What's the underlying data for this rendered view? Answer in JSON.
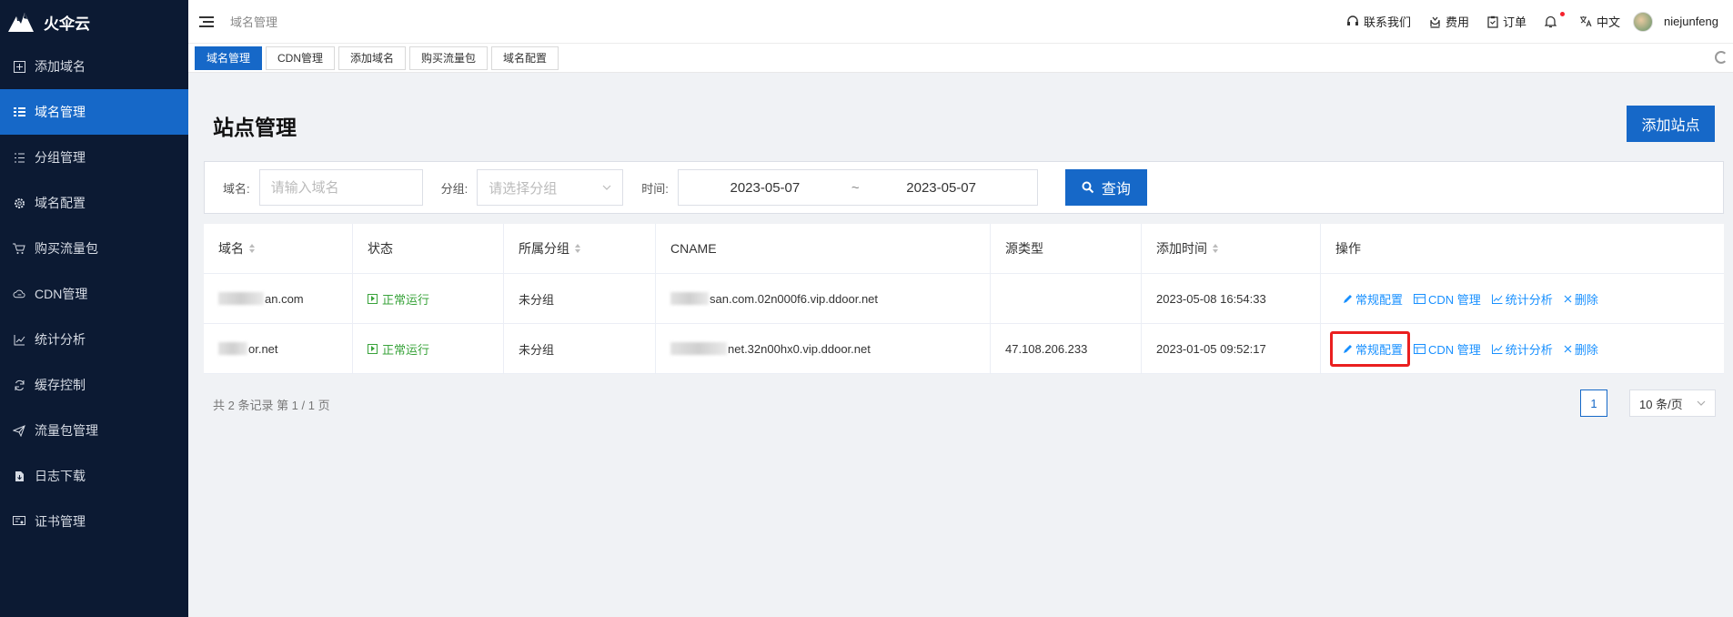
{
  "brand": {
    "name": "火伞云"
  },
  "sidebar": {
    "items": [
      {
        "label": "添加域名",
        "icon": "plus-square-icon",
        "active": false
      },
      {
        "label": "域名管理",
        "icon": "list-icon",
        "active": true
      },
      {
        "label": "分组管理",
        "icon": "group-list-icon",
        "active": false
      },
      {
        "label": "域名配置",
        "icon": "gear-icon",
        "active": false
      },
      {
        "label": "购买流量包",
        "icon": "cart-icon",
        "active": false
      },
      {
        "label": "CDN管理",
        "icon": "cloud-icon",
        "active": false
      },
      {
        "label": "统计分析",
        "icon": "line-chart-icon",
        "active": false
      },
      {
        "label": "缓存控制",
        "icon": "refresh-icon",
        "active": false
      },
      {
        "label": "流量包管理",
        "icon": "paper-plane-icon",
        "active": false
      },
      {
        "label": "日志下载",
        "icon": "file-download-icon",
        "active": false
      },
      {
        "label": "证书管理",
        "icon": "certificate-icon",
        "active": false
      }
    ]
  },
  "topbar": {
    "breadcrumb": "域名管理",
    "contact": "联系我们",
    "fees": "费用",
    "orders": "订单",
    "language": "中文",
    "username": "niejunfeng"
  },
  "tabs": [
    {
      "label": "域名管理",
      "active": true
    },
    {
      "label": "CDN管理",
      "active": false
    },
    {
      "label": "添加域名",
      "active": false
    },
    {
      "label": "购买流量包",
      "active": false
    },
    {
      "label": "域名配置",
      "active": false
    }
  ],
  "page": {
    "title": "站点管理",
    "add_button": "添加站点"
  },
  "filters": {
    "domain_label": "域名:",
    "domain_placeholder": "请输入域名",
    "group_label": "分组:",
    "group_placeholder": "请选择分组",
    "time_label": "时间:",
    "date_start": "2023-05-07",
    "date_sep": "~",
    "date_end": "2023-05-07",
    "query_button": "查询"
  },
  "table": {
    "headers": [
      "域名",
      "状态",
      "所属分组",
      "CNAME",
      "源类型",
      "添加时间",
      "操作"
    ],
    "rows": [
      {
        "domain_suffix": "an.com",
        "status": "正常运行",
        "group": "未分组",
        "cname_suffix": "san.com.02n000f6.vip.ddoor.net",
        "source_type": "",
        "added": "2023-05-08 16:54:33"
      },
      {
        "domain_suffix": "or.net",
        "status": "正常运行",
        "group": "未分组",
        "cname_suffix": "net.32n00hx0.vip.ddoor.net",
        "source_type": "47.108.206.233",
        "added": "2023-01-05 09:52:17"
      }
    ],
    "actions": {
      "config": "常规配置",
      "cdn": "CDN 管理",
      "stats": "统计分析",
      "delete": "删除"
    }
  },
  "footer": {
    "total": "共 2 条记录 第 1 / 1 页",
    "current_page": "1",
    "page_size": "10 条/页"
  },
  "colors": {
    "primary": "#1668c8",
    "sidebar_bg": "#0c1a33",
    "success": "#38a33a",
    "link": "#1890ff",
    "highlight": "#ea1f1f"
  }
}
